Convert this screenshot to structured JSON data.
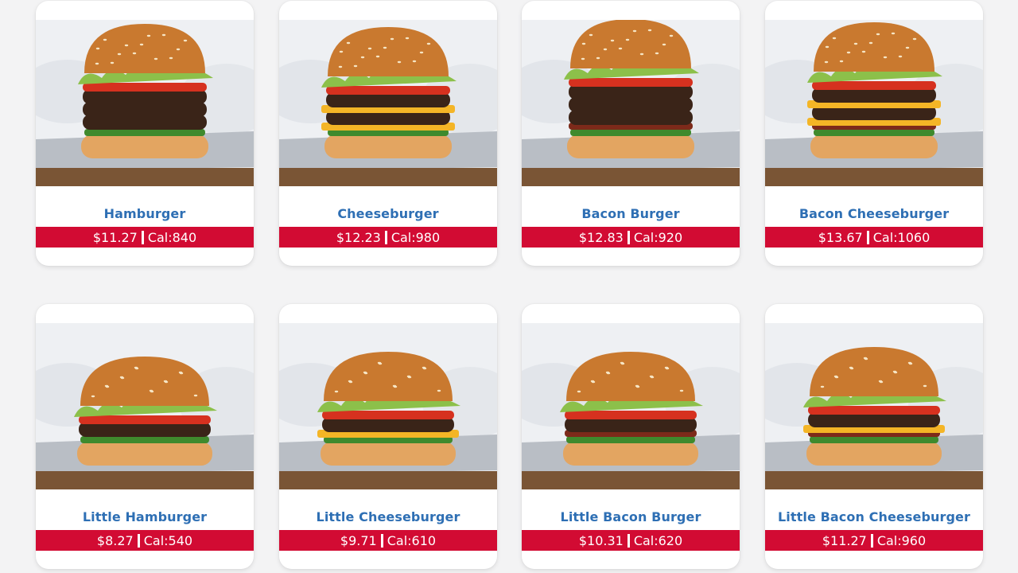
{
  "colors": {
    "name": "#2e6fb4",
    "price_bar": "#d20b33",
    "card_bg": "#ffffff",
    "page_bg": "#f3f3f4"
  },
  "menu": {
    "items": [
      {
        "name": "Hamburger",
        "price": "$11.27",
        "cal": "Cal:840",
        "size": "regular",
        "patties": 3,
        "cheese": false,
        "bacon": false
      },
      {
        "name": "Cheeseburger",
        "price": "$12.23",
        "cal": "Cal:980",
        "size": "regular",
        "patties": 2,
        "cheese": true,
        "bacon": false
      },
      {
        "name": "Bacon Burger",
        "price": "$12.83",
        "cal": "Cal:920",
        "size": "regular",
        "patties": 3,
        "cheese": false,
        "bacon": true
      },
      {
        "name": "Bacon Cheeseburger",
        "price": "$13.67",
        "cal": "Cal:1060",
        "size": "regular",
        "patties": 2,
        "cheese": true,
        "bacon": true
      },
      {
        "name": "Little Hamburger",
        "price": "$8.27",
        "cal": "Cal:540",
        "size": "little",
        "patties": 1,
        "cheese": false,
        "bacon": false
      },
      {
        "name": "Little Cheeseburger",
        "price": "$9.71",
        "cal": "Cal:610",
        "size": "little",
        "patties": 1,
        "cheese": true,
        "bacon": false
      },
      {
        "name": "Little Bacon Burger",
        "price": "$10.31",
        "cal": "Cal:620",
        "size": "little",
        "patties": 1,
        "cheese": false,
        "bacon": true
      },
      {
        "name": "Little Bacon Cheeseburger",
        "price": "$11.27",
        "cal": "Cal:960",
        "size": "little",
        "patties": 1,
        "cheese": true,
        "bacon": true
      }
    ]
  }
}
